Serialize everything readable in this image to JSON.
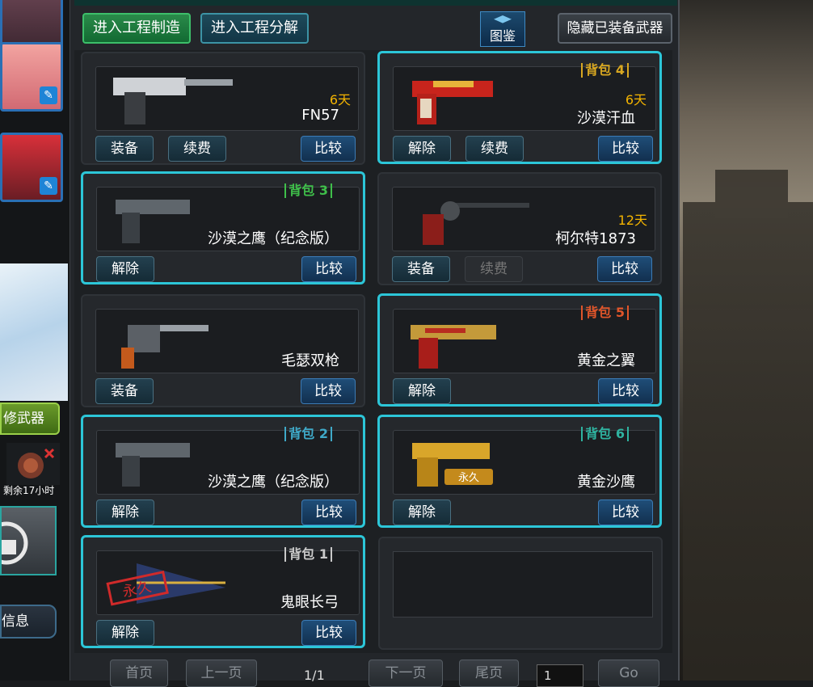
{
  "toolbar": {
    "enter_craft": "进入工程制造",
    "enter_decompose": "进入工程分解",
    "codex": "图鉴",
    "hide_equipped": "隐藏已装备武器"
  },
  "weapons": [
    {
      "name": "FN57",
      "days": "6天",
      "bag": "",
      "btn1": "装备",
      "btn2": "续费",
      "compare": "比较"
    },
    {
      "name": "沙漠汗血",
      "days": "6天",
      "bag": "背包 4",
      "btn1": "解除",
      "btn2": "续费",
      "compare": "比较"
    },
    {
      "name": "沙漠之鹰（纪念版）",
      "days": "",
      "bag": "背包 3",
      "btn1": "解除",
      "btn2": "",
      "compare": "比较"
    },
    {
      "name": "柯尔特1873",
      "days": "12天",
      "bag": "",
      "btn1": "装备",
      "btn2": "续费",
      "compare": "比较"
    },
    {
      "name": "毛瑟双枪",
      "days": "",
      "bag": "",
      "btn1": "装备",
      "btn2": "",
      "compare": "比较"
    },
    {
      "name": "黄金之翼",
      "days": "",
      "bag": "背包 5",
      "btn1": "解除",
      "btn2": "",
      "compare": "比较"
    },
    {
      "name": "沙漠之鹰（纪念版）",
      "days": "",
      "bag": "背包 2",
      "btn1": "解除",
      "btn2": "",
      "compare": "比较"
    },
    {
      "name": "黄金沙鹰",
      "days": "",
      "bag": "背包 6",
      "btn1": "解除",
      "btn2": "",
      "compare": "比较",
      "stamp": "永久"
    },
    {
      "name": "鬼眼长弓",
      "days": "",
      "bag": "背包 1",
      "btn1": "解除",
      "btn2": "",
      "compare": "比较",
      "stamp": "永久"
    }
  ],
  "pager": {
    "first": "首页",
    "prev": "上一页",
    "info": "1/1",
    "next": "下一页",
    "last": "尾页",
    "page_input": "1",
    "go": "Go"
  },
  "sidebar": {
    "repair": "修武器",
    "remaining": "剩余17小时",
    "info": "信息"
  }
}
